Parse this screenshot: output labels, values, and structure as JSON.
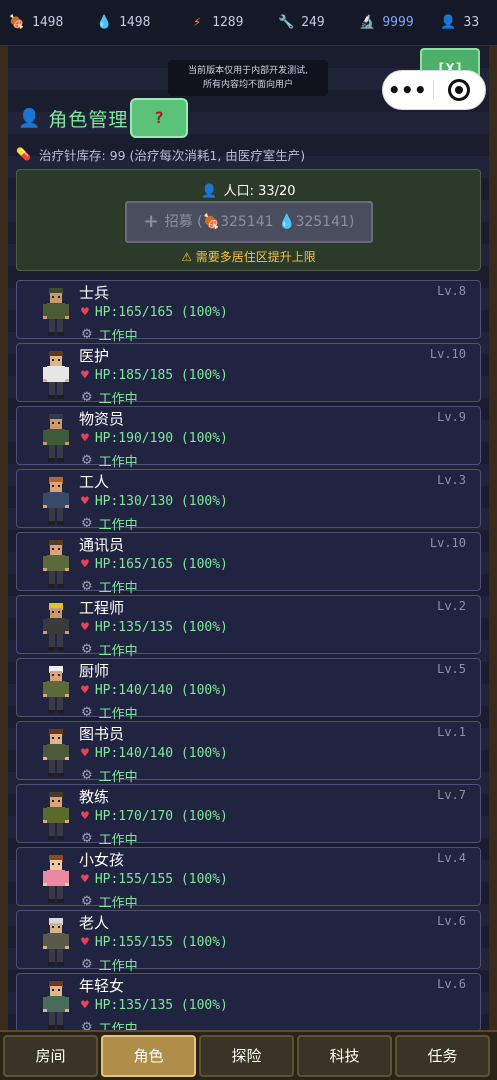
{
  "resources": [
    {
      "icon": "meat-icon",
      "glyph": "🍖",
      "value": "1498",
      "color": "#c9634a",
      "cls": "res-food"
    },
    {
      "icon": "water-drop-icon",
      "glyph": "💧",
      "value": "1498",
      "color": "#5aa4e0",
      "cls": "res-water"
    },
    {
      "icon": "lightning-icon",
      "glyph": "⚡",
      "value": "1289",
      "color": "#f0a02a",
      "cls": "res-power"
    },
    {
      "icon": "wrench-icon",
      "glyph": "🔧",
      "value": "249",
      "color": "#b8bcc8",
      "cls": "res-parts"
    },
    {
      "icon": "microscope-icon",
      "glyph": "🔬",
      "value": "9999",
      "color": "#9fb0c8",
      "cls": "res-tech"
    },
    {
      "icon": "people-icon",
      "glyph": "👤",
      "value": "33",
      "color": "#6fa3ff",
      "cls": "res-pop"
    }
  ],
  "notice": {
    "line1": "当前版本仅用于内部开发测试,",
    "line2": "所有内容均不面向用户"
  },
  "close_label": "[X]",
  "capsule": {
    "menu": "•••"
  },
  "title": "角色管理",
  "help_label": "?",
  "stock_text": "治疗针库存: 99 (治疗每次消耗1, 由医疗室生产)",
  "population": {
    "label": "人口: 33/20",
    "recruit_label": "招募 (",
    "food_cost": "325141",
    "water_cost": "325141",
    "recruit_close": ")",
    "warning": "需要多居住区提升上限"
  },
  "characters": [
    {
      "name": "士兵",
      "level": "Lv.8",
      "hp": "HP:165/165 (100%)",
      "status": "工作中",
      "skin": "#c9996b",
      "hair": "#3f4a2f",
      "body": "#4d5a34"
    },
    {
      "name": "医护",
      "level": "Lv.10",
      "hp": "HP:185/185 (100%)",
      "status": "工作中",
      "skin": "#e0b48a",
      "hair": "#5a3a22",
      "body": "#e6e6e6"
    },
    {
      "name": "物资员",
      "level": "Lv.9",
      "hp": "HP:190/190 (100%)",
      "status": "工作中",
      "skin": "#c9996b",
      "hair": "#2f3a4a",
      "body": "#3f5a3a"
    },
    {
      "name": "工人",
      "level": "Lv.3",
      "hp": "HP:130/130 (100%)",
      "status": "工作中",
      "skin": "#d9a47a",
      "hair": "#b8642a",
      "body": "#3a4a6a"
    },
    {
      "name": "通讯员",
      "level": "Lv.10",
      "hp": "HP:165/165 (100%)",
      "status": "工作中",
      "skin": "#d9a47a",
      "hair": "#5a3a22",
      "body": "#5a6a3a"
    },
    {
      "name": "工程师",
      "level": "Lv.2",
      "hp": "HP:135/135 (100%)",
      "status": "工作中",
      "skin": "#c9996b",
      "hair": "#e6c02a",
      "body": "#3a3a3a"
    },
    {
      "name": "厨师",
      "level": "Lv.5",
      "hp": "HP:140/140 (100%)",
      "status": "工作中",
      "skin": "#d9a47a",
      "hair": "#f0f0f0",
      "body": "#5a6a3a"
    },
    {
      "name": "图书员",
      "level": "Lv.1",
      "hp": "HP:140/140 (100%)",
      "status": "工作中",
      "skin": "#e0b48a",
      "hair": "#6a3a1a",
      "body": "#4a5a3a"
    },
    {
      "name": "教练",
      "level": "Lv.7",
      "hp": "HP:170/170 (100%)",
      "status": "工作中",
      "skin": "#d9a47a",
      "hair": "#4a3a2a",
      "body": "#5a6a2a"
    },
    {
      "name": "小女孩",
      "level": "Lv.4",
      "hp": "HP:155/155 (100%)",
      "status": "工作中",
      "skin": "#f0c8a0",
      "hair": "#8a4a2a",
      "body": "#e88aa0"
    },
    {
      "name": "老人",
      "level": "Lv.6",
      "hp": "HP:155/155 (100%)",
      "status": "工作中",
      "skin": "#d9b48a",
      "hair": "#d8d8d8",
      "body": "#5a5a4a"
    },
    {
      "name": "年轻女",
      "level": "Lv.6",
      "hp": "HP:135/135 (100%)",
      "status": "工作中",
      "skin": "#e0b48a",
      "hair": "#6a3a1a",
      "body": "#4a6a5a"
    }
  ],
  "nav": [
    {
      "label": "房间",
      "active": false
    },
    {
      "label": "角色",
      "active": true
    },
    {
      "label": "探险",
      "active": false
    },
    {
      "label": "科技",
      "active": false
    },
    {
      "label": "任务",
      "active": false
    }
  ]
}
